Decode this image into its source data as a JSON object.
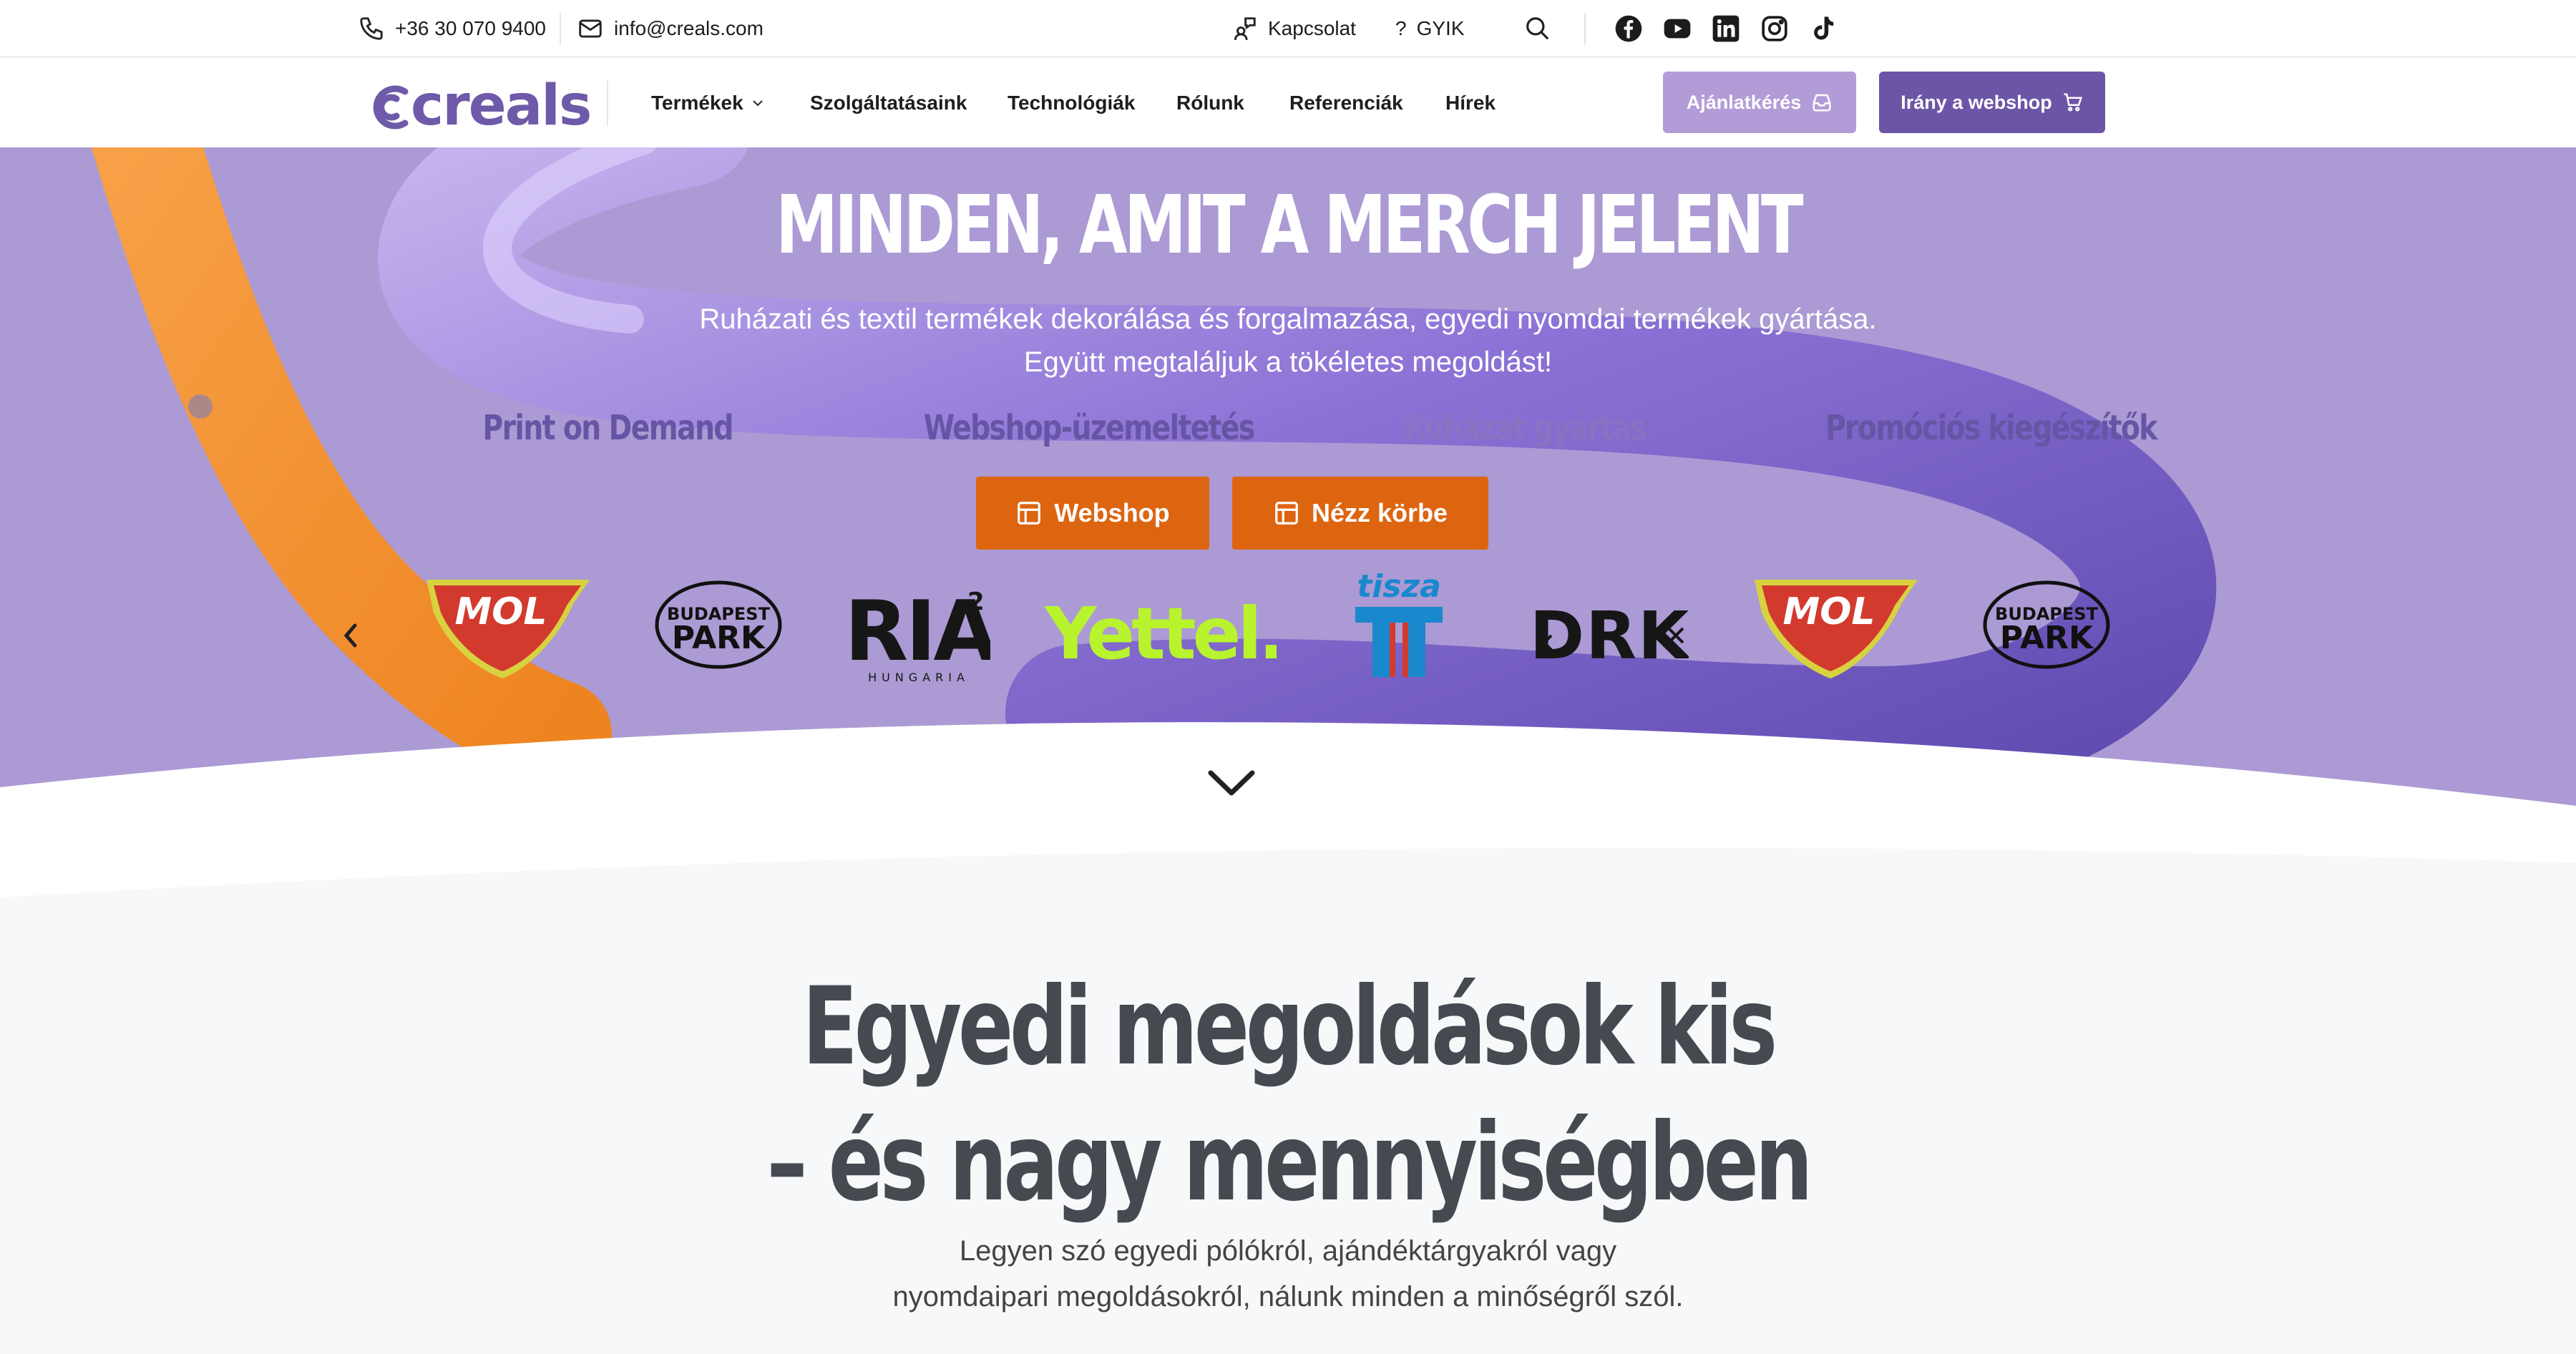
{
  "topbar": {
    "phone": "+36 30 070 9400",
    "email": "info@creals.com",
    "contact_label": "Kapcsolat",
    "faq_label": "GYIK"
  },
  "nav": {
    "logo_text": "creals",
    "links": [
      "Termékek",
      "Szolgáltatásaink",
      "Technológiák",
      "Rólunk",
      "Referenciák",
      "Hírek"
    ],
    "quote_button": "Ajánlatkérés",
    "webshop_button": "Irány a webshop"
  },
  "hero": {
    "title": "MINDEN, AMIT A MERCH JELENT",
    "subtitle_line1": "Ruházati és textil termékek dekorálása és forgalmazása, egyedi nyomdai termékek gyártása.",
    "subtitle_line2": "Együtt megtaláljuk a tökéletes megoldást!",
    "features": [
      "Print on Demand",
      "Webshop-üzemeltetés",
      "Ruházat gyártás",
      "Promóciós kiegészítők"
    ],
    "buttons": [
      "Webshop",
      "Nézz körbe"
    ],
    "clients": {
      "mol": "MOL",
      "budapest_park_top": "BUDAPEST",
      "budapest_park_bottom": "PARK",
      "ria": "RIA",
      "ria_sup": "2",
      "ria_sub": "HUNGARIA",
      "yettel": "Yettel.",
      "tisza": "tisza",
      "drk": "DRK"
    }
  },
  "section": {
    "title_line1": "Egyedi megoldások kis",
    "title_line2": "– és nagy mennyiségben",
    "subtitle_line1": "Legyen szó egyedi pólókról, ajándéktárgyakról vagy",
    "subtitle_line2": "nyomdaipari megoldásokról, nálunk minden a minőségről szól."
  },
  "colors": {
    "hero_bg": "#ab9ad4",
    "accent_purple": "#6c55a6",
    "quote_button": "#b29cd8",
    "cta_orange": "#dd6510"
  }
}
